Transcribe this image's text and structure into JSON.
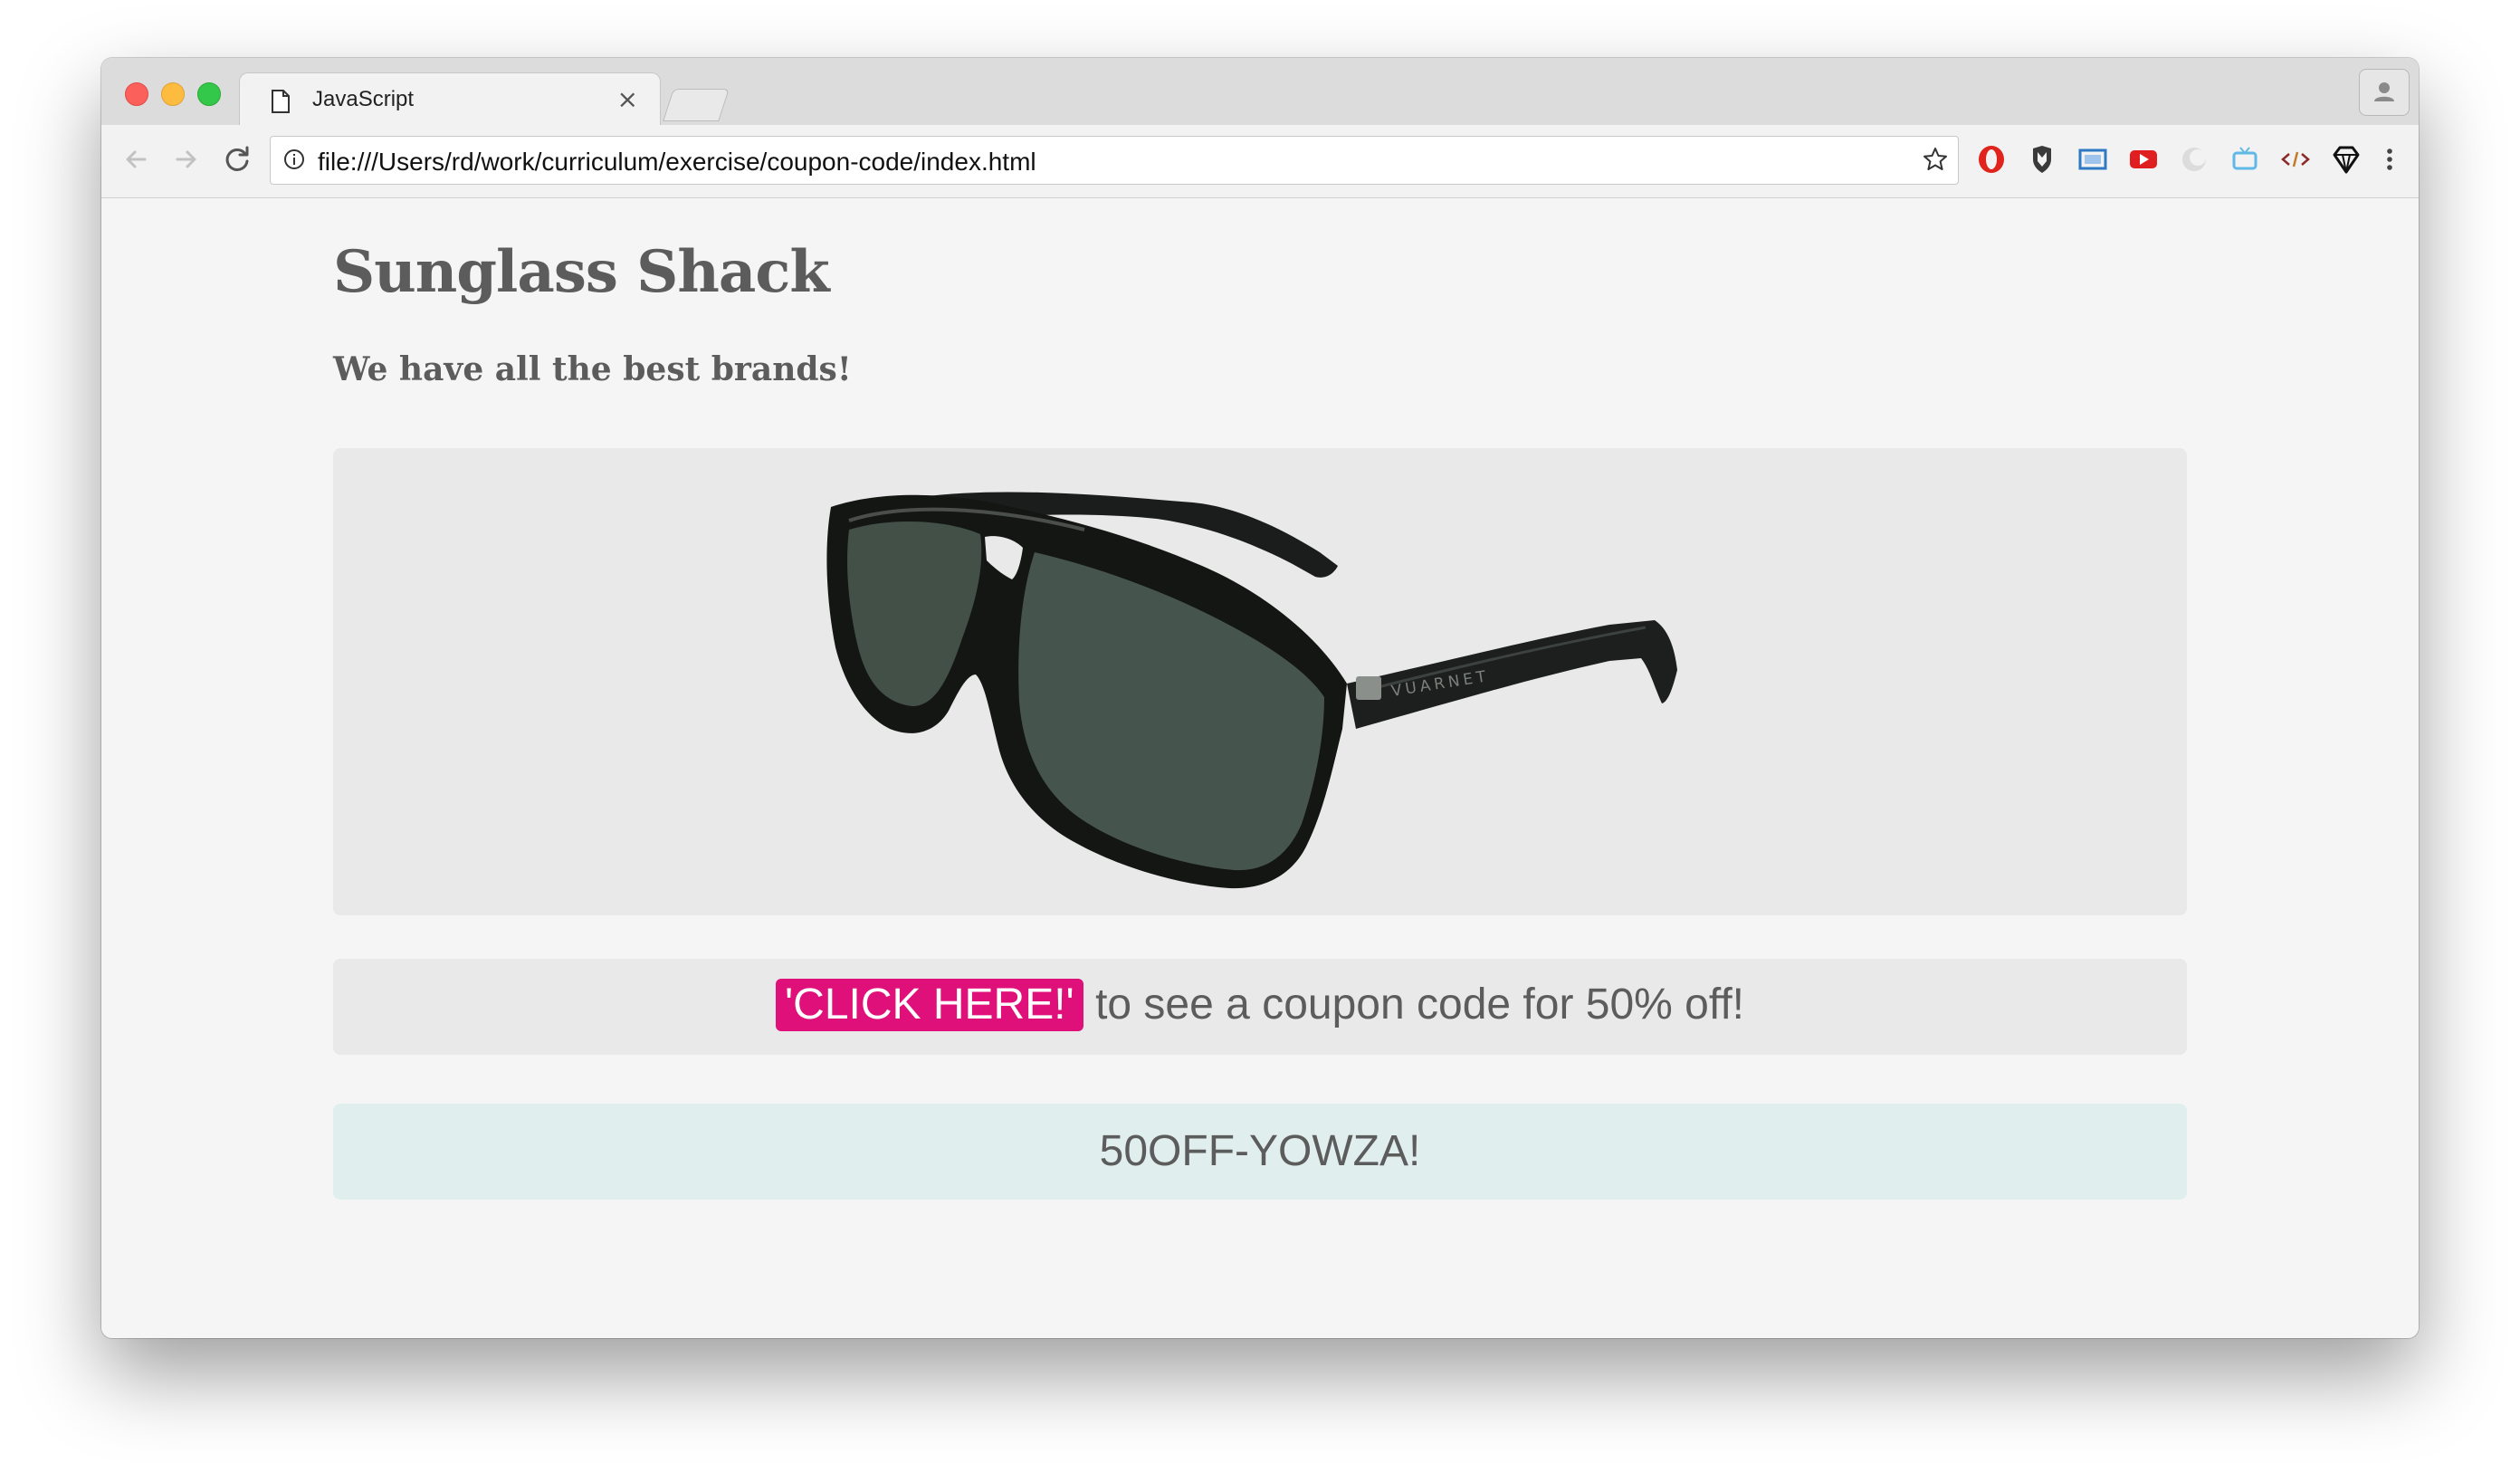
{
  "browser": {
    "tab": {
      "title": "JavaScript",
      "close_glyph": "×"
    },
    "address_bar": {
      "url": "file:///Users/rd/work/curriculum/exercise/coupon-code/index.html"
    },
    "extensions": [
      "opera-icon",
      "shield-icon",
      "screen-capture-icon",
      "youtube-icon",
      "ghost-icon",
      "tv-icon",
      "code-icon",
      "diamond-icon"
    ]
  },
  "page": {
    "title": "Sunglass Shack",
    "tagline": "We have all the best brands!",
    "product": {
      "brand_mark": "VUARNET"
    },
    "coupon": {
      "button_label": "'CLICK HERE!'",
      "text": "to see a coupon code for 50% off!"
    },
    "code": {
      "value": "50OFF-YOWZA!"
    }
  },
  "colors": {
    "accent": "#e0107a",
    "page_background": "#f5f5f5",
    "panel_background": "#e9e9e9",
    "code_background": "#e1eeee",
    "text": "#5c5c5c"
  }
}
